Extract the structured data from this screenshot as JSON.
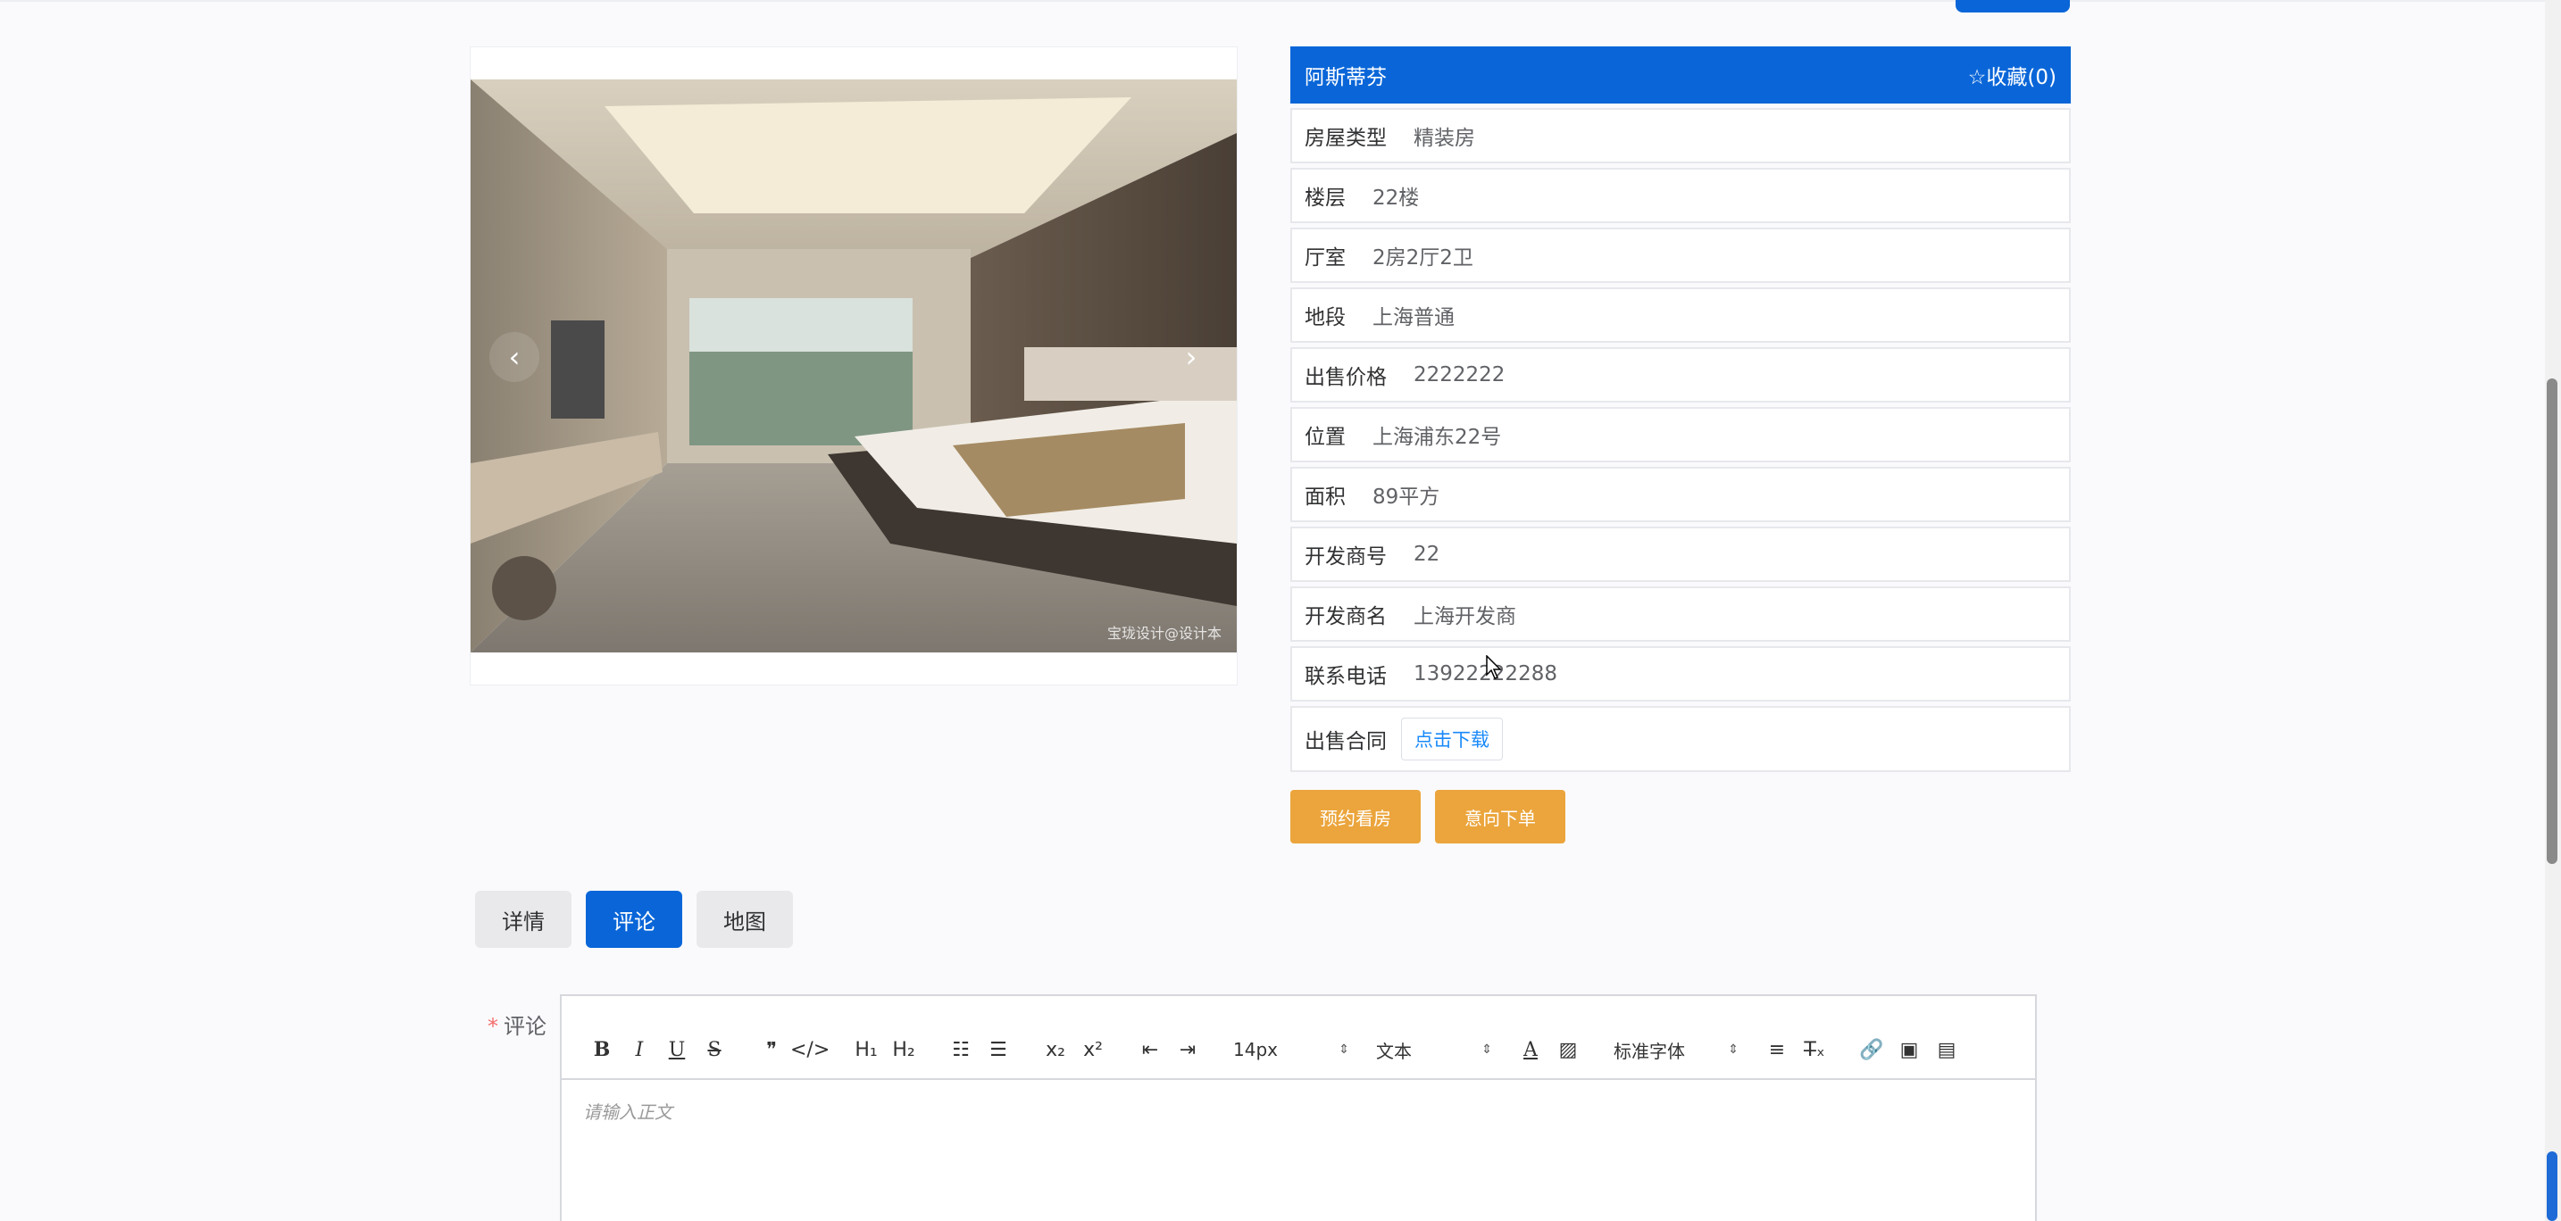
{
  "listing": {
    "title": "阿斯蒂芬",
    "favorite_label": "☆收藏(0)",
    "rows": [
      {
        "label": "房屋类型",
        "value": "精装房"
      },
      {
        "label": "楼层",
        "value": "22楼"
      },
      {
        "label": "厅室",
        "value": "2房2厅2卫"
      },
      {
        "label": "地段",
        "value": "上海普通"
      },
      {
        "label": "出售价格",
        "value": "2222222"
      },
      {
        "label": "位置",
        "value": "上海浦东22号"
      },
      {
        "label": "面积",
        "value": "89平方"
      },
      {
        "label": "开发商号",
        "value": "22"
      },
      {
        "label": "开发商名",
        "value": "上海开发商"
      },
      {
        "label": "联系电话",
        "value": "13922222288"
      }
    ],
    "contract": {
      "label": "出售合同",
      "button": "点击下载"
    },
    "actions": {
      "book": "预约看房",
      "order": "意向下单"
    }
  },
  "carousel": {
    "prev": "‹",
    "next": "›",
    "watermark": "宝珑设计@设计本"
  },
  "tabs": [
    {
      "label": "详情",
      "active": false
    },
    {
      "label": "评论",
      "active": true
    },
    {
      "label": "地图",
      "active": false
    }
  ],
  "comment": {
    "required_mark": "*",
    "label": "评论",
    "placeholder": "请输入正文",
    "toolbar": {
      "font_size": "14px",
      "text_style": "文本",
      "font_family": "标准字体"
    }
  },
  "colors": {
    "primary": "#0a66d8",
    "orange": "#eba53c",
    "link": "#1989fa"
  }
}
